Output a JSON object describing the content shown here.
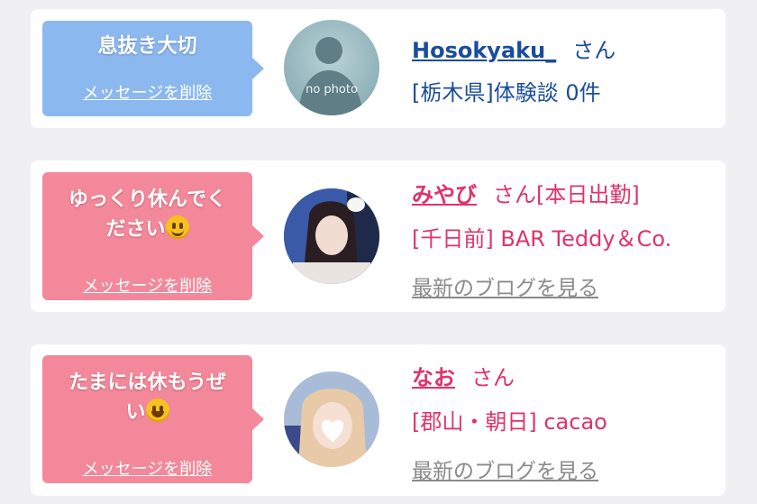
{
  "cards": [
    {
      "message": "息抜き大切",
      "delete_label": "メッセージを削除",
      "name": "Hosokyaku_",
      "suffix": "さん",
      "detail": "[栃木県]体験談 0件",
      "avatar_text": "no photo",
      "bubble_color": "#8cb8f0",
      "text_color": "#1a4d9c"
    },
    {
      "message_line1": "ゆっくり休んでく",
      "message_line2": "ださい",
      "emoji": "smiling-face-icon",
      "delete_label": "メッセージを削除",
      "name": "みやび",
      "suffix": "さん",
      "status": "[本日出勤]",
      "shop": "[千日前] BAR Teddy＆Co.",
      "blog_label": "最新のブログを見る",
      "bubble_color": "#f3889a",
      "text_color": "#e0336a"
    },
    {
      "message_line1": "たまには休もうぜ",
      "message_line2": "い",
      "emoji": "grinning-face-icon",
      "delete_label": "メッセージを削除",
      "name": "なお",
      "suffix": "さん",
      "shop": "[郡山・朝日] cacao",
      "blog_label": "最新のブログを見る",
      "bubble_color": "#f3889a",
      "text_color": "#e0336a"
    }
  ]
}
